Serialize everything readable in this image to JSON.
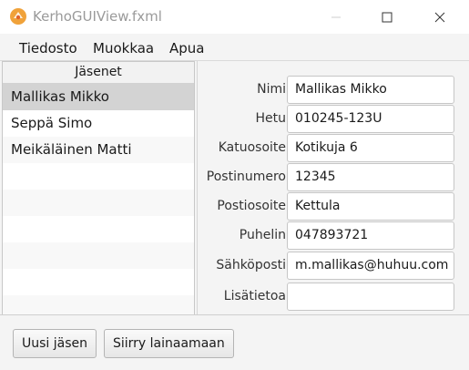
{
  "window": {
    "title": "KerhoGUIView.fxml",
    "accent_color": "#f0a23a"
  },
  "menu": [
    "Tiedosto",
    "Muokkaa",
    "Apua"
  ],
  "members_list": {
    "header": "Jäsenet",
    "items": [
      "Mallikas Mikko",
      "Seppä Simo",
      "Meikäläinen Matti"
    ],
    "selected_index": 0
  },
  "form": {
    "fields": [
      {
        "label": "Nimi",
        "value": "Mallikas Mikko"
      },
      {
        "label": "Hetu",
        "value": "010245-123U"
      },
      {
        "label": "Katuosoite",
        "value": "Kotikuja 6"
      },
      {
        "label": "Postinumero",
        "value": "12345"
      },
      {
        "label": "Postiosoite",
        "value": "Kettula"
      },
      {
        "label": "Puhelin",
        "value": "047893721"
      },
      {
        "label": "Sähköposti",
        "value": "m.mallikas@huhuu.com"
      },
      {
        "label": "Lisätietoa",
        "value": ""
      }
    ]
  },
  "buttons": {
    "new_member": "Uusi jäsen",
    "go_lend": "Siirry lainaamaan"
  }
}
